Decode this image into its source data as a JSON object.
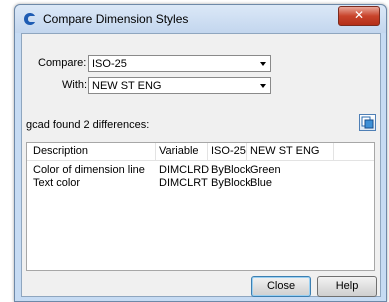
{
  "window": {
    "title": "Compare Dimension Styles",
    "close_glyph": "✕"
  },
  "compare": {
    "label": "Compare:",
    "value": "ISO-25"
  },
  "with": {
    "label": "With:",
    "value": "NEW ST ENG"
  },
  "found_text": "gcad found 2 differences:",
  "table": {
    "columns": [
      "Description",
      "Variable",
      "ISO-25",
      "NEW ST ENG"
    ],
    "rows": [
      [
        "Color of dimension line",
        "DIMCLRD",
        "ByBlock",
        "Green"
      ],
      [
        "Text color",
        "DIMCLRT",
        "ByBlock",
        "Blue"
      ]
    ]
  },
  "buttons": {
    "close": "Close",
    "help": "Help"
  },
  "icons": {
    "app": "app-logo-icon",
    "copy": "copy-to-clipboard-icon"
  },
  "colors": {
    "title_bar": "#c6dbf3",
    "close_button": "#c8432b",
    "client": "#f0f0f0"
  }
}
